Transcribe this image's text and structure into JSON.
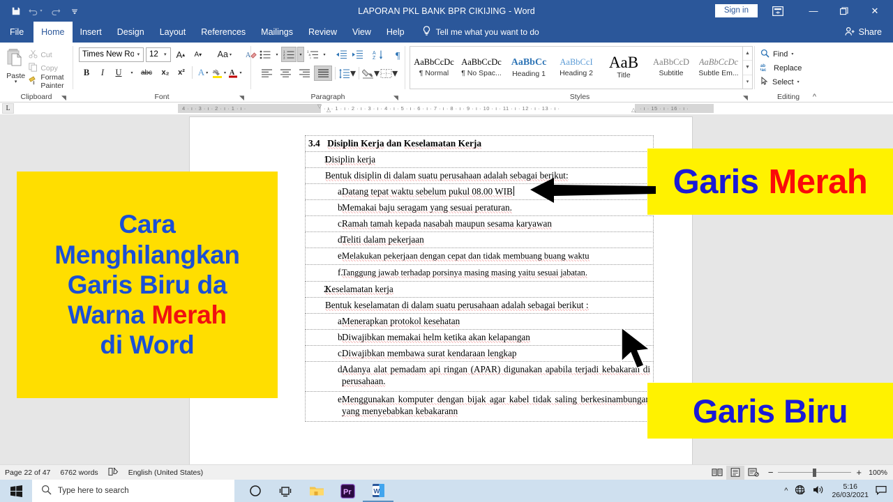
{
  "titlebar": {
    "document_title": "LAPORAN PKL BANK BPR CIKIJING  -  Word",
    "save_icon": "save-icon",
    "undo_icon": "undo-icon",
    "redo_icon": "redo-icon",
    "customize_icon": "customize-quick-access-icon",
    "sign_in": "Sign in",
    "ribbon_display_icon": "ribbon-display-options-icon",
    "minimize": "—",
    "restore": "❐",
    "close": "✕"
  },
  "tabs": [
    {
      "label": "File",
      "active": false
    },
    {
      "label": "Home",
      "active": true
    },
    {
      "label": "Insert",
      "active": false
    },
    {
      "label": "Design",
      "active": false
    },
    {
      "label": "Layout",
      "active": false
    },
    {
      "label": "References",
      "active": false
    },
    {
      "label": "Mailings",
      "active": false
    },
    {
      "label": "Review",
      "active": false
    },
    {
      "label": "View",
      "active": false
    },
    {
      "label": "Help",
      "active": false
    }
  ],
  "tellme": {
    "label": "Tell me what you want to do",
    "icon": "lightbulb-icon"
  },
  "share": {
    "label": "Share",
    "icon": "share-person-icon"
  },
  "ribbon": {
    "clipboard": {
      "group_label": "Clipboard",
      "paste_label": "Paste",
      "cut_label": "Cut",
      "copy_label": "Copy",
      "format_painter_label": "Format Painter"
    },
    "font": {
      "group_label": "Font",
      "font_name": "Times New Ro",
      "font_size": "12",
      "grow_font": "A",
      "shrink_font": "A",
      "change_case": "Aa",
      "clear_formatting_icon": "clear-formatting-icon",
      "bold": "B",
      "italic": "I",
      "underline": "U",
      "strikethrough": "abc",
      "subscript": "x₂",
      "superscript": "x²",
      "text_effects": "A",
      "highlight": "ab",
      "font_color": "A"
    },
    "paragraph": {
      "group_label": "Paragraph",
      "bullets_icon": "bullet-list-icon",
      "numbering_icon": "numbered-list-icon",
      "multilevel_icon": "multilevel-list-icon",
      "decrease_indent_icon": "decrease-indent-icon",
      "increase_indent_icon": "increase-indent-icon",
      "sort_icon": "sort-az-icon",
      "show_marks_icon": "pilcrow-icon",
      "align_left_icon": "align-left-icon",
      "align_center_icon": "align-center-icon",
      "align_right_icon": "align-right-icon",
      "justify_icon": "justify-icon",
      "line_spacing_icon": "line-spacing-icon",
      "shading_icon": "shading-icon",
      "borders_icon": "borders-icon"
    },
    "styles": {
      "group_label": "Styles",
      "items": [
        {
          "preview": "AaBbCcDc",
          "name": "¶ Normal"
        },
        {
          "preview": "AaBbCcDc",
          "name": "¶ No Spac..."
        },
        {
          "preview": "AaBbCc",
          "name": "Heading 1"
        },
        {
          "preview": "AaBbCcI",
          "name": "Heading 2"
        },
        {
          "preview": "AaB",
          "name": "Title"
        },
        {
          "preview": "AaBbCcD",
          "name": "Subtitle"
        },
        {
          "preview": "AaBbCcDc",
          "name": "Subtle Em..."
        }
      ]
    },
    "editing": {
      "group_label": "Editing",
      "find_label": "Find",
      "replace_label": "Replace",
      "select_label": "Select",
      "find_icon": "magnifier-icon",
      "replace_icon": "replace-icon",
      "select_icon": "pointer-icon",
      "collapse_icon": "collapse-ribbon-icon"
    }
  },
  "ruler": {
    "tab_stop_selector": "L",
    "left_ticks": "4  ·  ı  ·  3  ·  ı  ·  2  ·  ı  ·  1  ·  ı  ·",
    "right_ticks": "· ı · 1 · ı · 2 · ı · 3 · ı · 4 · ı · 5 · ı · 6 · ı · 7 · ı · 8 · ı · 9 · ı · 10 · ı · 11 · ı · 12 · ı · 13 · ı ·",
    "far_right_ticks": "· ı · 15 · ı · 16 · ı ·"
  },
  "document": {
    "heading": {
      "number": "3.4",
      "text_a": "Disiplin Kerja",
      "text_b": " dan ",
      "text_c": "Keselamatan Kerja"
    },
    "lines": [
      {
        "marker": "1.",
        "level": 1,
        "text": "Disiplin kerja",
        "squiggle": true
      },
      {
        "marker": "",
        "level": 1,
        "text": "Bentuk disiplin di dalam suatu perusahaan adalah sebagai berikut:",
        "squiggle": true
      },
      {
        "marker": "a.",
        "level": 2,
        "text": "Datang tepat waktu sebelum pukul 08.00 WIB",
        "squiggle": true,
        "caret": true
      },
      {
        "marker": "b.",
        "level": 2,
        "text": "Memakai baju seragam yang sesuai peraturan.",
        "squiggle": true
      },
      {
        "marker": "c.",
        "level": 2,
        "text": "Ramah tamah kepada nasabah maupun sesama karyawan",
        "squiggle": true
      },
      {
        "marker": "d.",
        "level": 2,
        "text": "Teliti dalam pekerjaan",
        "squiggle": true
      },
      {
        "marker": "e.",
        "level": 2,
        "text": "Melakukan pekerjaan dengan cepat dan tidak membuang buang waktu",
        "squiggle": true,
        "justify": true
      },
      {
        "marker": "f.",
        "level": 2,
        "text": "Tanggung jawab terhadap porsinya masing masing yaitu sesuai jabatan.",
        "squiggle": true,
        "justify": true
      },
      {
        "marker": "2.",
        "level": 1,
        "text": "Keselamatan kerja",
        "squiggle": true
      },
      {
        "marker": "",
        "level": 1,
        "text": "Bentuk keselamatan di dalam suatu perusahaan adalah sebagai berikut :",
        "squiggle": true
      },
      {
        "marker": "a.",
        "level": 2,
        "text": "Menerapkan protokol kesehatan",
        "squiggle": true
      },
      {
        "marker": "b.",
        "level": 2,
        "text": "Diwajibkan memakai helm ketika akan kelapangan",
        "squiggle": true
      },
      {
        "marker": "c.",
        "level": 2,
        "text": "Diwajibkan membawa surat kendaraan lengkap",
        "squiggle": true
      },
      {
        "marker": "d.",
        "level": 2,
        "text": "Adanya alat pemadam api ringan (APAR) digunakan apabila terjadi kebakaran di perusahaan.",
        "squiggle": true,
        "justify": true,
        "tall": true
      },
      {
        "marker": "e.",
        "level": 2,
        "text": "Menggunakan komputer dengan bijak agar kabel tidak saling berkesinambungan yang menyebabkan kebakarann",
        "squiggle": true,
        "justify": true,
        "tall": true
      }
    ]
  },
  "overlays": {
    "title_box": {
      "line1": "Cara",
      "line2": "Menghilangkan",
      "line3": "Garis Biru da",
      "line4_blue": "Warna ",
      "line4_red": "Merah",
      "line5": "di Word",
      "bg_color": "#ffde00",
      "blue": "#1a4fd6",
      "red": "#f01010"
    },
    "merah_box": {
      "word1": "Garis",
      "word2": "Merah",
      "bg_color": "#fff200",
      "blue": "#1a1ad6",
      "red": "#fa0a0a"
    },
    "biru_box": {
      "label": "Garis Biru",
      "bg_color": "#fff200",
      "blue": "#1a1ad6"
    },
    "arrow_red": "arrow-pointing-left-icon",
    "arrow_cursor": "mouse-pointer-arrow-icon"
  },
  "statusbar": {
    "page": "Page 22 of 47",
    "words": "6762 words",
    "proofing_icon": "proofing-errors-icon",
    "language": "English (United States)",
    "read_mode_icon": "read-mode-icon",
    "print_layout_icon": "print-layout-icon",
    "web_layout_icon": "web-layout-icon",
    "zoom_out": "−",
    "zoom_in": "+",
    "zoom_level": "100%"
  },
  "taskbar": {
    "start_icon": "windows-start-icon",
    "search_icon": "search-icon",
    "search_placeholder": "Type here to search",
    "cortana_icon": "cortana-circle-icon",
    "task_view_icon": "task-view-icon",
    "explorer_icon": "file-explorer-icon",
    "premiere_icon": "adobe-premiere-icon",
    "word_icon": "microsoft-word-icon",
    "tray_up_icon": "show-hidden-icons-icon",
    "network_icon": "network-globe-icon",
    "volume_icon": "volume-icon",
    "time": "5:16",
    "date": "26/03/2021",
    "notification_icon": "notifications-icon"
  }
}
